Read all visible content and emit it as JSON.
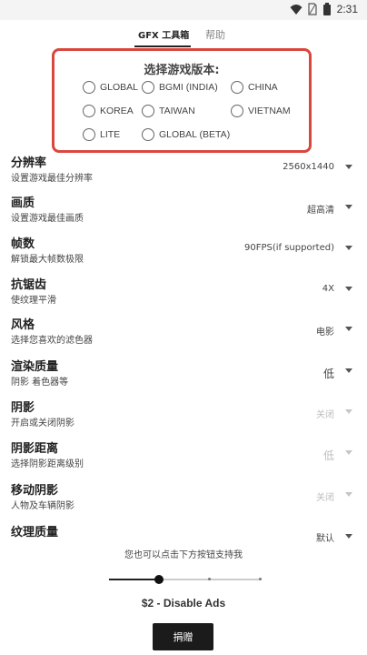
{
  "status_bar": {
    "time": "2:31"
  },
  "tabs": [
    {
      "label": "GFX 工具箱",
      "active": true
    },
    {
      "label": "帮助",
      "active": false
    }
  ],
  "version_selector": {
    "title": "选择游戏版本:",
    "options": [
      "GLOBAL",
      "BGMI (INDIA)",
      "CHINA",
      "KOREA",
      "TAIWAN",
      "VIETNAM",
      "LITE",
      "GLOBAL (BETA)"
    ]
  },
  "settings": [
    {
      "title": "分辨率",
      "desc": "设置游戏最佳分辨率",
      "value": "2560x1440",
      "enabled": true
    },
    {
      "title": "画质",
      "desc": "设置游戏最佳画质",
      "value": "超高清",
      "enabled": true
    },
    {
      "title": "帧数",
      "desc": "解锁最大帧数极限",
      "value": "90FPS(if supported)",
      "enabled": true
    },
    {
      "title": "抗锯齿",
      "desc": "使纹理平滑",
      "value": "4X",
      "enabled": true
    },
    {
      "title": "风格",
      "desc": "选择您喜欢的滤色器",
      "value": "电影",
      "enabled": true
    },
    {
      "title": "渲染质量",
      "desc": "阴影 着色器等",
      "value": "低",
      "enabled": true
    },
    {
      "title": "阴影",
      "desc": "开启或关闭阴影",
      "value": "关闭",
      "enabled": false
    },
    {
      "title": "阴影距离",
      "desc": "选择阴影距离级别",
      "value": "低",
      "enabled": false
    },
    {
      "title": "移动阴影",
      "desc": "人物及车辆阴影",
      "value": "关闭",
      "enabled": false
    },
    {
      "title": "纹理质量",
      "desc": "",
      "value": "默认",
      "enabled": true
    }
  ],
  "support": {
    "text": "您也可以点击下方按钮支持我",
    "slider_position": 0.33,
    "price_label": "$2 - Disable Ads",
    "donate_label": "捐赠"
  },
  "colors": {
    "highlight_border": "#d9473d",
    "button_bg": "#1b1b1b"
  },
  "icons": [
    "wifi-icon",
    "sim-icon",
    "battery-icon",
    "dropdown-caret-icon"
  ]
}
